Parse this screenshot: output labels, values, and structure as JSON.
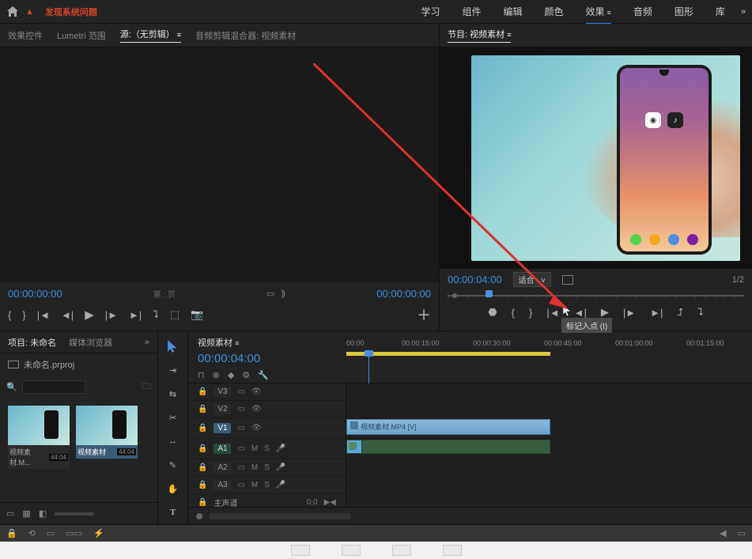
{
  "topbar": {
    "warning_text": "发现系统问题",
    "workspaces": [
      "学习",
      "组件",
      "编辑",
      "颜色",
      "效果",
      "音频",
      "图形",
      "库"
    ],
    "active_workspace": "效果"
  },
  "source_panel": {
    "tabs": [
      "效果控件",
      "Lumetri 范围",
      "源:（无剪辑）",
      "音频剪辑混合器: 视频素材"
    ],
    "active_tab": "源:（无剪辑）",
    "timecode_left": "00:00:00:00",
    "timecode_right": "00:00:00:00",
    "page_drop": "第 : 页"
  },
  "program_panel": {
    "title": "节目: 视频素材",
    "timecode": "00:00:04:00",
    "fit_label": "适合",
    "fraction": "1/2",
    "tooltip": "标记入点 (I)"
  },
  "project": {
    "tabs": [
      "项目: 未命名",
      "媒体浏览器"
    ],
    "active_tab": "项目: 未命名",
    "root_item": "未命名.prproj",
    "clips": [
      {
        "name": "视频素材.M...",
        "dur": "44:04"
      },
      {
        "name": "视频素材",
        "dur": "44:04"
      }
    ]
  },
  "timeline": {
    "sequence_name": "视频素材",
    "timecode": "00:00:04:00",
    "ruler": [
      "00:00",
      "00:00:15:00",
      "00:00:30:00",
      "00:00:45:00",
      "00:01:00:00",
      "00:01:15:00"
    ],
    "tracks_v": [
      "V3",
      "V2",
      "V1"
    ],
    "tracks_a": [
      "A1",
      "A2",
      "A3"
    ],
    "master_label": "主声道",
    "clip_label": "视频素材.MP4 [V]",
    "audio_toggles": {
      "m": "M",
      "s": "S"
    }
  }
}
